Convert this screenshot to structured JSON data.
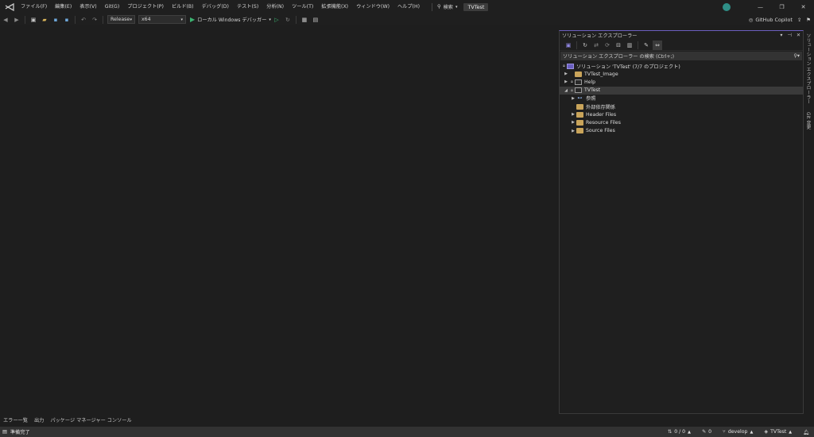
{
  "menu": {
    "items": [
      "ファイル(F)",
      "編集(E)",
      "表示(V)",
      "Git(G)",
      "プロジェクト(P)",
      "ビルド(B)",
      "デバッグ(D)",
      "テスト(S)",
      "分析(N)",
      "ツール(T)",
      "拡張機能(X)",
      "ウィンドウ(W)",
      "ヘルプ(H)"
    ],
    "search_label": "検索",
    "project_badge": "TVTest"
  },
  "window_controls": {
    "minimize": "—",
    "restore": "❐",
    "close": "✕"
  },
  "toolbar": {
    "configuration": "Release",
    "platform": "x64",
    "run_label": "ローカル Windows デバッガー",
    "copilot_label": "GitHub Copilot"
  },
  "solution_explorer": {
    "title": "ソリューション エクスプローラー",
    "search_placeholder": "ソリューション エクスプローラー の検索 (Ctrl+;)",
    "tree": {
      "solution": "ソリューション 'TVTest' (7/7 のプロジェクト)",
      "proj_image": "TVTest_Image",
      "proj_help": "Help",
      "proj_tvtest": "TVTest",
      "ref": "参照",
      "external_deps": "外部依存関係",
      "header_files": "Header Files",
      "resource_files": "Resource Files",
      "source_files": "Source Files"
    }
  },
  "side_tabs": [
    "ソリューション エクスプローラー",
    "Git 変更"
  ],
  "bottom_tabs": [
    "エラー一覧",
    "出力",
    "パッケージ マネージャー コンソール"
  ],
  "status": {
    "ready": "準備完了",
    "sync": "0 / 0",
    "changes": "0",
    "branch": "develop",
    "repo": "TVTest"
  },
  "colors": {
    "accent": "#6b5fbf",
    "run_green": "#3cb371",
    "folder": "#c9a45a",
    "background": "#1e1e1e",
    "statusbar": "#323232"
  }
}
